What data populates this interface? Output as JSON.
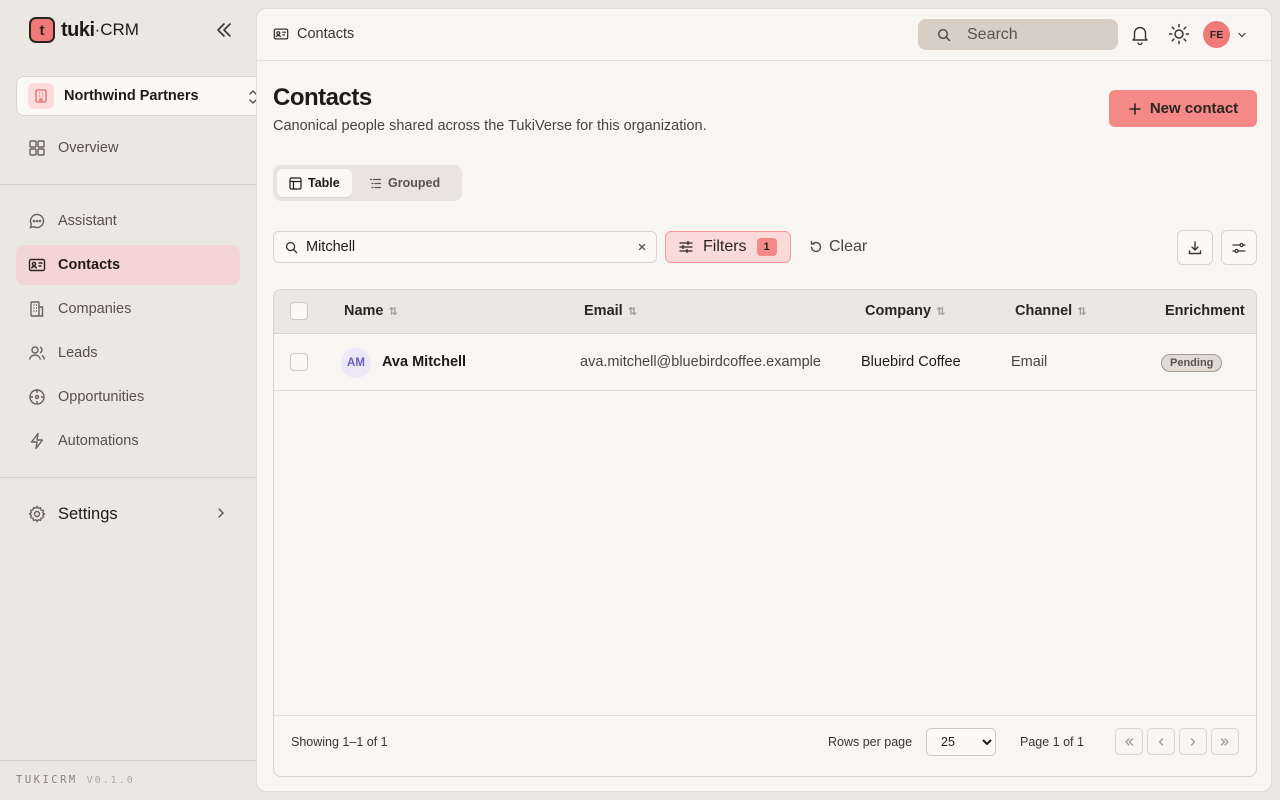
{
  "brand": {
    "logo_glyph": "t",
    "name": "tuki",
    "suffix": "·CRM"
  },
  "org": {
    "name": "Northwind Partners"
  },
  "nav": {
    "overview": "Overview",
    "assistant": "Assistant",
    "contacts": "Contacts",
    "companies": "Companies",
    "leads": "Leads",
    "opportunities": "Opportunities",
    "automations": "Automations",
    "settings": "Settings"
  },
  "footer": {
    "brand": "TUKICRM",
    "version": "V0.1.0"
  },
  "topbar": {
    "breadcrumb": "Contacts",
    "search_label": "Search",
    "user_initials": "FE"
  },
  "page": {
    "title": "Contacts",
    "subtitle": "Canonical people shared across the TukiVerse for this organization.",
    "new_button": "New contact"
  },
  "views": {
    "table": "Table",
    "grouped": "Grouped"
  },
  "toolbar": {
    "search_value": "Mitchell",
    "filters_label": "Filters",
    "filters_count": "1",
    "clear_label": "Clear"
  },
  "table": {
    "headers": {
      "name": "Name",
      "email": "Email",
      "company": "Company",
      "channel": "Channel",
      "enrichment": "Enrichment"
    },
    "rows": [
      {
        "initials": "AM",
        "name": "Ava Mitchell",
        "email": "ava.mitchell@bluebirdcoffee.example",
        "company": "Bluebird Coffee",
        "channel": "Email",
        "enrichment": "Pending"
      }
    ]
  },
  "pagination": {
    "showing": "Showing 1–1 of 1",
    "rows_per_page_label": "Rows per page",
    "rows_per_page": "25",
    "page_of": "Page 1 of 1"
  },
  "colors": {
    "accent": "#f48987",
    "active_nav": "#f3d6d3",
    "sidebar_bg": "#ebe7e1",
    "panel_bg": "#f8f6f3"
  }
}
